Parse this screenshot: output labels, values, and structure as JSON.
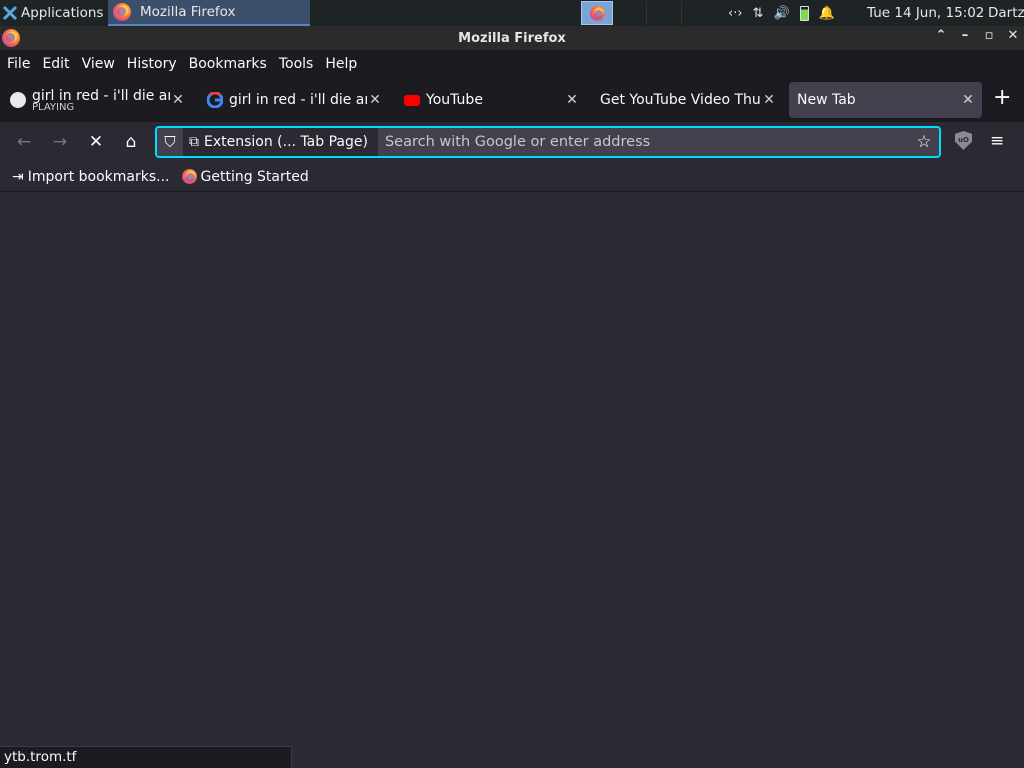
{
  "panel": {
    "applications_label": "Applications",
    "task_title": "Mozilla Firefox",
    "clock": "Tue 14 Jun, 15:02",
    "user": "Dartz"
  },
  "window": {
    "title": "Mozilla Firefox"
  },
  "menu": {
    "file": "File",
    "edit": "Edit",
    "view": "View",
    "history": "History",
    "bookmarks": "Bookmarks",
    "tools": "Tools",
    "help": "Help"
  },
  "tabs": [
    {
      "label": "girl in red - i'll die anyway",
      "sub": "PLAYING",
      "icon": "audio-spinner-icon"
    },
    {
      "label": "girl in red - i'll die anyway",
      "icon": "google-icon"
    },
    {
      "label": "YouTube",
      "icon": "youtube-icon"
    },
    {
      "label": "Get YouTube Video Thumbnail",
      "icon": "none"
    },
    {
      "label": "New Tab",
      "icon": "none",
      "active": true
    }
  ],
  "urlbar": {
    "identity": "Extension (... Tab Page)",
    "placeholder": "Search with Google or enter address",
    "value": ""
  },
  "bookmarks": [
    {
      "label": "Import bookmarks...",
      "icon": "import-icon"
    },
    {
      "label": "Getting Started",
      "icon": "firefox-icon"
    }
  ],
  "status_text": "ytb.trom.tf",
  "colors": {
    "accent_focus": "#00ddff",
    "toolbar_bg": "#2b2a33",
    "tabbar_bg": "#1c1b22"
  }
}
